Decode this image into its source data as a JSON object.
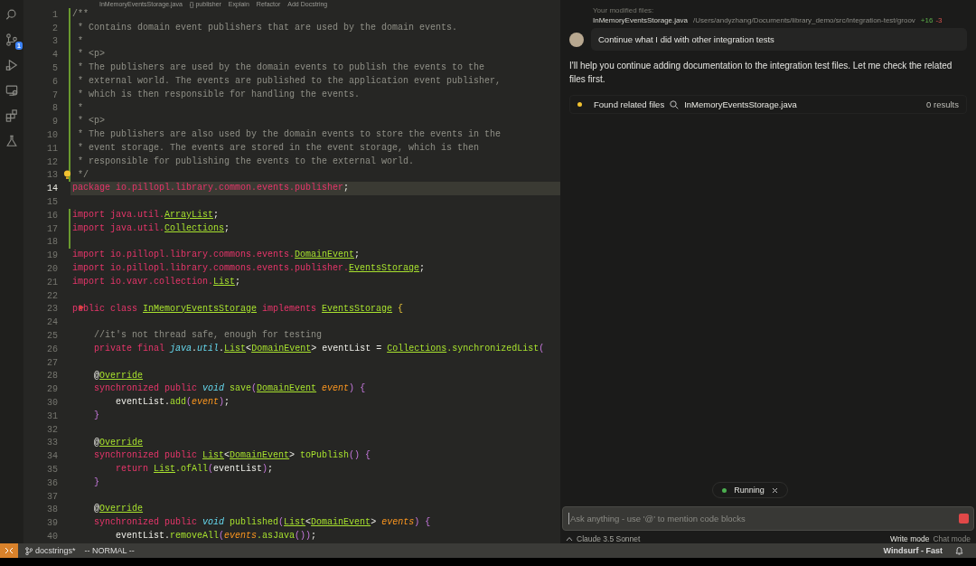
{
  "activity_bar": [
    {
      "kind": "search"
    },
    {
      "kind": "source-control",
      "badge": "1"
    },
    {
      "kind": "run"
    },
    {
      "kind": "remote"
    },
    {
      "kind": "extensions"
    },
    {
      "kind": "testing"
    }
  ],
  "editor": {
    "breadcrumb": [
      "InMemoryEventsStorage.java",
      "{} publisher"
    ],
    "code_lens": [
      "Explain",
      "Refactor",
      "Add Docstring"
    ],
    "lines": [
      {
        "n": "1",
        "added": true,
        "current": false,
        "tokens": [
          {
            "kind": "comment",
            "text": "/**"
          }
        ]
      },
      {
        "n": "2",
        "added": true,
        "current": false,
        "tokens": [
          {
            "kind": "comment",
            "text": " * Contains domain event publishers that are used by the domain events."
          }
        ]
      },
      {
        "n": "3",
        "added": true,
        "current": false,
        "tokens": [
          {
            "kind": "comment",
            "text": " *"
          }
        ]
      },
      {
        "n": "4",
        "added": true,
        "current": false,
        "tokens": [
          {
            "kind": "comment",
            "text": " * <p>"
          }
        ]
      },
      {
        "n": "5",
        "added": true,
        "current": false,
        "tokens": [
          {
            "kind": "comment",
            "text": " * The publishers are used by the domain events to publish the events to the"
          }
        ]
      },
      {
        "n": "6",
        "added": true,
        "current": false,
        "tokens": [
          {
            "kind": "comment",
            "text": " * external world. The events are published to the application event publisher,"
          }
        ]
      },
      {
        "n": "7",
        "added": true,
        "current": false,
        "tokens": [
          {
            "kind": "comment",
            "text": " * which is then responsible for handling the events."
          }
        ]
      },
      {
        "n": "8",
        "added": true,
        "current": false,
        "tokens": [
          {
            "kind": "comment",
            "text": " *"
          }
        ]
      },
      {
        "n": "9",
        "added": true,
        "current": false,
        "tokens": [
          {
            "kind": "comment",
            "text": " * <p>"
          }
        ]
      },
      {
        "n": "10",
        "added": true,
        "current": false,
        "tokens": [
          {
            "kind": "comment",
            "text": " * The publishers are also used by the domain events to store the events in the"
          }
        ]
      },
      {
        "n": "11",
        "added": true,
        "current": false,
        "tokens": [
          {
            "kind": "comment",
            "text": " * event storage. The events are stored in the event storage, which is then"
          }
        ]
      },
      {
        "n": "12",
        "added": true,
        "current": false,
        "tokens": [
          {
            "kind": "comment",
            "text": " * responsible for publishing the events to the external world."
          }
        ]
      },
      {
        "n": "13",
        "added": true,
        "current": false,
        "lightbulb": true,
        "tokens": [
          {
            "kind": "comment",
            "text": " */"
          }
        ]
      },
      {
        "n": "14",
        "added": false,
        "current": true,
        "tokens": [
          {
            "kind": "keyword",
            "text": "package io.pillopl.library.common.events.publisher"
          },
          {
            "kind": "plain",
            "text": ";"
          }
        ]
      },
      {
        "n": "15",
        "added": false,
        "current": false
      },
      {
        "n": "16",
        "added": true,
        "current": false,
        "tokens": [
          {
            "kind": "keyword",
            "text": "import java.util."
          },
          {
            "kind": "type",
            "text": "ArrayList"
          },
          {
            "kind": "plain",
            "text": ";"
          }
        ]
      },
      {
        "n": "17",
        "added": true,
        "current": false,
        "tokens": [
          {
            "kind": "keyword",
            "text": "import java.util."
          },
          {
            "kind": "type",
            "text": "Collections"
          },
          {
            "kind": "plain",
            "text": ";"
          }
        ]
      },
      {
        "n": "18",
        "added": true,
        "current": false
      },
      {
        "n": "19",
        "added": false,
        "current": false,
        "tokens": [
          {
            "kind": "keyword",
            "text": "import io.pillopl.library.commons.events."
          },
          {
            "kind": "type",
            "text": "DomainEvent"
          },
          {
            "kind": "plain",
            "text": ";"
          }
        ]
      },
      {
        "n": "20",
        "added": false,
        "current": false,
        "tokens": [
          {
            "kind": "keyword",
            "text": "import io.pillopl.library.commons.events.publisher."
          },
          {
            "kind": "type",
            "text": "EventsStorage"
          },
          {
            "kind": "plain",
            "text": ";"
          }
        ]
      },
      {
        "n": "21",
        "added": false,
        "current": false,
        "tokens": [
          {
            "kind": "keyword",
            "text": "import io.vavr.collection."
          },
          {
            "kind": "type",
            "text": "List"
          },
          {
            "kind": "plain",
            "text": ";"
          }
        ]
      },
      {
        "n": "22",
        "added": false,
        "current": false
      },
      {
        "n": "23",
        "added": false,
        "current": false,
        "marker": true,
        "tokens": [
          {
            "kind": "keyword",
            "text": "public class "
          },
          {
            "kind": "type",
            "text": "InMemoryEventsStorage"
          },
          {
            "kind": "keyword",
            "text": " implements "
          },
          {
            "kind": "type",
            "text": "EventsStorage"
          },
          {
            "kind": "brace",
            "text": " {"
          }
        ]
      },
      {
        "n": "24",
        "added": false,
        "current": false
      },
      {
        "n": "25",
        "added": false,
        "current": false,
        "tokens": [
          {
            "kind": "comment",
            "text": "    //it's not thread safe, enough for testing"
          }
        ]
      },
      {
        "n": "26",
        "added": false,
        "current": false,
        "tokens": [
          {
            "kind": "keyword",
            "text": "    private final "
          },
          {
            "kind": "builtin",
            "text": "java"
          },
          {
            "kind": "plain",
            "text": "."
          },
          {
            "kind": "builtin",
            "text": "util"
          },
          {
            "kind": "plain",
            "text": "."
          },
          {
            "kind": "type",
            "text": "List"
          },
          {
            "kind": "plain",
            "text": "<"
          },
          {
            "kind": "type",
            "text": "DomainEvent"
          },
          {
            "kind": "plain",
            "text": "> eventList = "
          },
          {
            "kind": "type",
            "text": "Collections"
          },
          {
            "kind": "method",
            "text": ".synchronizedList"
          },
          {
            "kind": "bracket",
            "text": "("
          }
        ]
      },
      {
        "n": "27",
        "added": false,
        "current": false
      },
      {
        "n": "28",
        "added": false,
        "current": false,
        "tokens": [
          {
            "kind": "plain",
            "text": "    @"
          },
          {
            "kind": "type",
            "text": "Override"
          }
        ]
      },
      {
        "n": "29",
        "added": false,
        "current": false,
        "tokens": [
          {
            "kind": "keyword",
            "text": "    synchronized public "
          },
          {
            "kind": "builtin",
            "text": "void"
          },
          {
            "kind": "method",
            "text": " save"
          },
          {
            "kind": "bracket",
            "text": "("
          },
          {
            "kind": "type",
            "text": "DomainEvent"
          },
          {
            "kind": "param",
            "text": " event"
          },
          {
            "kind": "bracket",
            "text": ")"
          },
          {
            "kind": "bracket",
            "text": " {"
          }
        ]
      },
      {
        "n": "30",
        "added": false,
        "current": false,
        "tokens": [
          {
            "kind": "plain",
            "text": "        eventList."
          },
          {
            "kind": "method",
            "text": "add"
          },
          {
            "kind": "bracket",
            "text": "("
          },
          {
            "kind": "param",
            "text": "event"
          },
          {
            "kind": "bracket",
            "text": ")"
          },
          {
            "kind": "plain",
            "text": ";"
          }
        ]
      },
      {
        "n": "31",
        "added": false,
        "current": false,
        "tokens": [
          {
            "kind": "bracket",
            "text": "    }"
          }
        ]
      },
      {
        "n": "32",
        "added": false,
        "current": false
      },
      {
        "n": "33",
        "added": false,
        "current": false,
        "tokens": [
          {
            "kind": "plain",
            "text": "    @"
          },
          {
            "kind": "type",
            "text": "Override"
          }
        ]
      },
      {
        "n": "34",
        "added": false,
        "current": false,
        "tokens": [
          {
            "kind": "keyword",
            "text": "    synchronized public "
          },
          {
            "kind": "type",
            "text": "List"
          },
          {
            "kind": "plain",
            "text": "<"
          },
          {
            "kind": "type",
            "text": "DomainEvent"
          },
          {
            "kind": "plain",
            "text": "> "
          },
          {
            "kind": "method",
            "text": "toPublish"
          },
          {
            "kind": "bracket",
            "text": "() {"
          }
        ]
      },
      {
        "n": "35",
        "added": false,
        "current": false,
        "tokens": [
          {
            "kind": "keyword",
            "text": "        return "
          },
          {
            "kind": "type",
            "text": "List"
          },
          {
            "kind": "method",
            "text": ".ofAll"
          },
          {
            "kind": "bracket",
            "text": "("
          },
          {
            "kind": "plain",
            "text": "eventList"
          },
          {
            "kind": "bracket",
            "text": ")"
          },
          {
            "kind": "plain",
            "text": ";"
          }
        ]
      },
      {
        "n": "36",
        "added": false,
        "current": false,
        "tokens": [
          {
            "kind": "bracket",
            "text": "    }"
          }
        ]
      },
      {
        "n": "37",
        "added": false,
        "current": false
      },
      {
        "n": "38",
        "added": false,
        "current": false,
        "tokens": [
          {
            "kind": "plain",
            "text": "    @"
          },
          {
            "kind": "type",
            "text": "Override"
          }
        ]
      },
      {
        "n": "39",
        "added": false,
        "current": false,
        "tokens": [
          {
            "kind": "keyword",
            "text": "    synchronized public "
          },
          {
            "kind": "builtin",
            "text": "void"
          },
          {
            "kind": "method",
            "text": " published"
          },
          {
            "kind": "bracket",
            "text": "("
          },
          {
            "kind": "type",
            "text": "List"
          },
          {
            "kind": "plain",
            "text": "<"
          },
          {
            "kind": "type",
            "text": "DomainEvent"
          },
          {
            "kind": "plain",
            "text": "> "
          },
          {
            "kind": "param",
            "text": "events"
          },
          {
            "kind": "bracket",
            "text": ") {"
          }
        ]
      },
      {
        "n": "40",
        "added": false,
        "current": false,
        "tokens": [
          {
            "kind": "plain",
            "text": "        eventList."
          },
          {
            "kind": "method",
            "text": "removeAll"
          },
          {
            "kind": "bracket",
            "text": "("
          },
          {
            "kind": "param",
            "text": "events"
          },
          {
            "kind": "method",
            "text": ".asJava"
          },
          {
            "kind": "bracket",
            "text": "())"
          },
          {
            "kind": "plain",
            "text": ";"
          }
        ]
      }
    ]
  },
  "chat": {
    "modified_label": "Your modified files:",
    "modified_files": [
      {
        "name": "InMemoryEventsStorage.java",
        "path": "/Users/andyzhang/Documents/library_demo/src/integration-test/groov",
        "added": "+16",
        "removed": "-3"
      }
    ],
    "user_message": "Continue what I did with other integration tests",
    "assistant_message": "I'll help you continue adding documentation to the integration test files. Let me check the related files first.",
    "steps": [
      {
        "label": "Found related files",
        "query": "InMemoryEventsStorage.java",
        "result": "0 results",
        "active": true
      }
    ],
    "running": {
      "label": "Running"
    },
    "input": {
      "placeholder": "Ask anything - use '@' to mention code blocks"
    },
    "model": "Claude 3.5 Sonnet",
    "modes": [
      {
        "label": "Write mode",
        "selected": true
      },
      {
        "label": "Chat mode",
        "selected": false
      }
    ]
  },
  "status_bar": {
    "branch": "docstrings*",
    "mode": "-- NORMAL --",
    "app": "Windsurf - Fast"
  }
}
